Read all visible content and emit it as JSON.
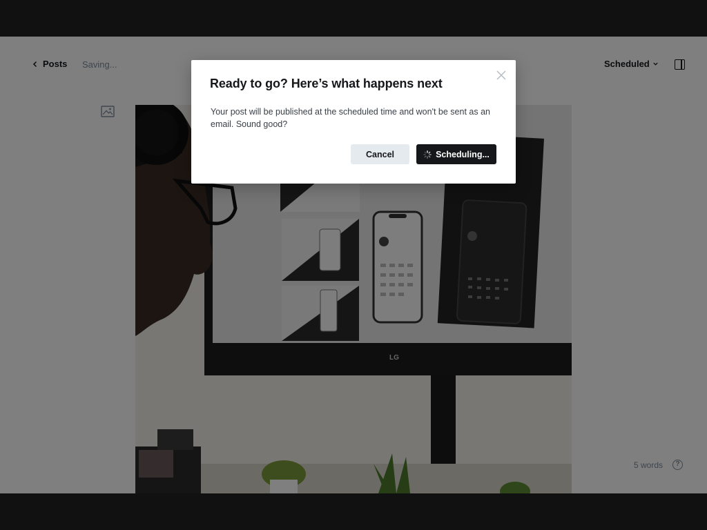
{
  "header": {
    "back_label": "Posts",
    "save_status": "Saving...",
    "post_status": "Scheduled"
  },
  "editor": {
    "word_count": "5 words",
    "help_glyph": "?"
  },
  "monitor": {
    "brand": "LG"
  },
  "modal": {
    "title": "Ready to go? Here’s what happens next",
    "body": "Your post will be published at the scheduled time and won't be sent as an email. Sound good?",
    "cancel_label": "Cancel",
    "confirm_label": "Scheduling..."
  },
  "colors": {
    "accent_dark": "#15171a",
    "cancel_bg": "#e5eaee",
    "muted_text": "#7c8b9a",
    "overlay": "rgba(0,0,0,0.5)"
  },
  "icons": {
    "back": "chevron-left-icon",
    "status": "chevron-down-icon",
    "sidebar": "sidebar-toggle-icon",
    "image": "image-icon",
    "close": "close-icon",
    "spinner": "spinner-icon",
    "help": "help-icon"
  }
}
